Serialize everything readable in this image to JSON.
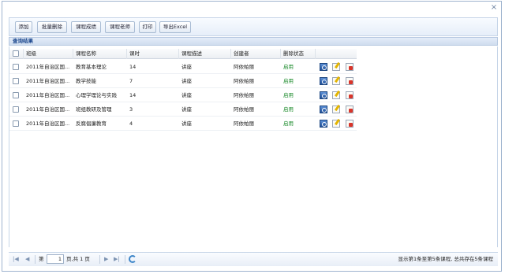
{
  "toolbar": {
    "buttons": [
      "添加",
      "批量删除",
      "课程成绩",
      "课程老师",
      "打印",
      "导出Excel"
    ]
  },
  "panel": {
    "title": "查询结果"
  },
  "table": {
    "headers": [
      "班级",
      "课程名称",
      "课时",
      "课程描述",
      "创建者",
      "删除状态"
    ],
    "rows": [
      {
        "class": "2011年自治区国...",
        "course": "教育基本理论",
        "hours": "14",
        "desc": "讲座",
        "creator": "阿依帕丽",
        "status": "启用"
      },
      {
        "class": "2011年自治区国...",
        "course": "教学技能",
        "hours": "7",
        "desc": "讲座",
        "creator": "阿依帕丽",
        "status": "启用"
      },
      {
        "class": "2011年自治区国...",
        "course": "心理学理论与实践",
        "hours": "14",
        "desc": "讲座",
        "creator": "阿依帕丽",
        "status": "启用"
      },
      {
        "class": "2011年自治区国...",
        "course": "班组教研及管理",
        "hours": "3",
        "desc": "讲座",
        "creator": "阿依帕丽",
        "status": "启用"
      },
      {
        "class": "2011年自治区国...",
        "course": "反腐倡廉教育",
        "hours": "4",
        "desc": "讲座",
        "creator": "阿依帕丽",
        "status": "启用"
      }
    ]
  },
  "pager": {
    "page_prefix": "第",
    "page_value": "1",
    "page_suffix": "页,共 1 页",
    "info": "显示第1条至第5条课程, 总共存在5条课程"
  },
  "icons": {
    "close": "close-icon",
    "row_actions": [
      "view-icon",
      "edit-icon",
      "delete-icon"
    ],
    "pager": [
      "first-page-icon",
      "prev-page-icon",
      "next-page-icon",
      "last-page-icon",
      "refresh-icon"
    ]
  },
  "colors": {
    "header_text": "#15428b",
    "status_enabled": "#1a8a2a",
    "accent": "#3e86c9"
  }
}
